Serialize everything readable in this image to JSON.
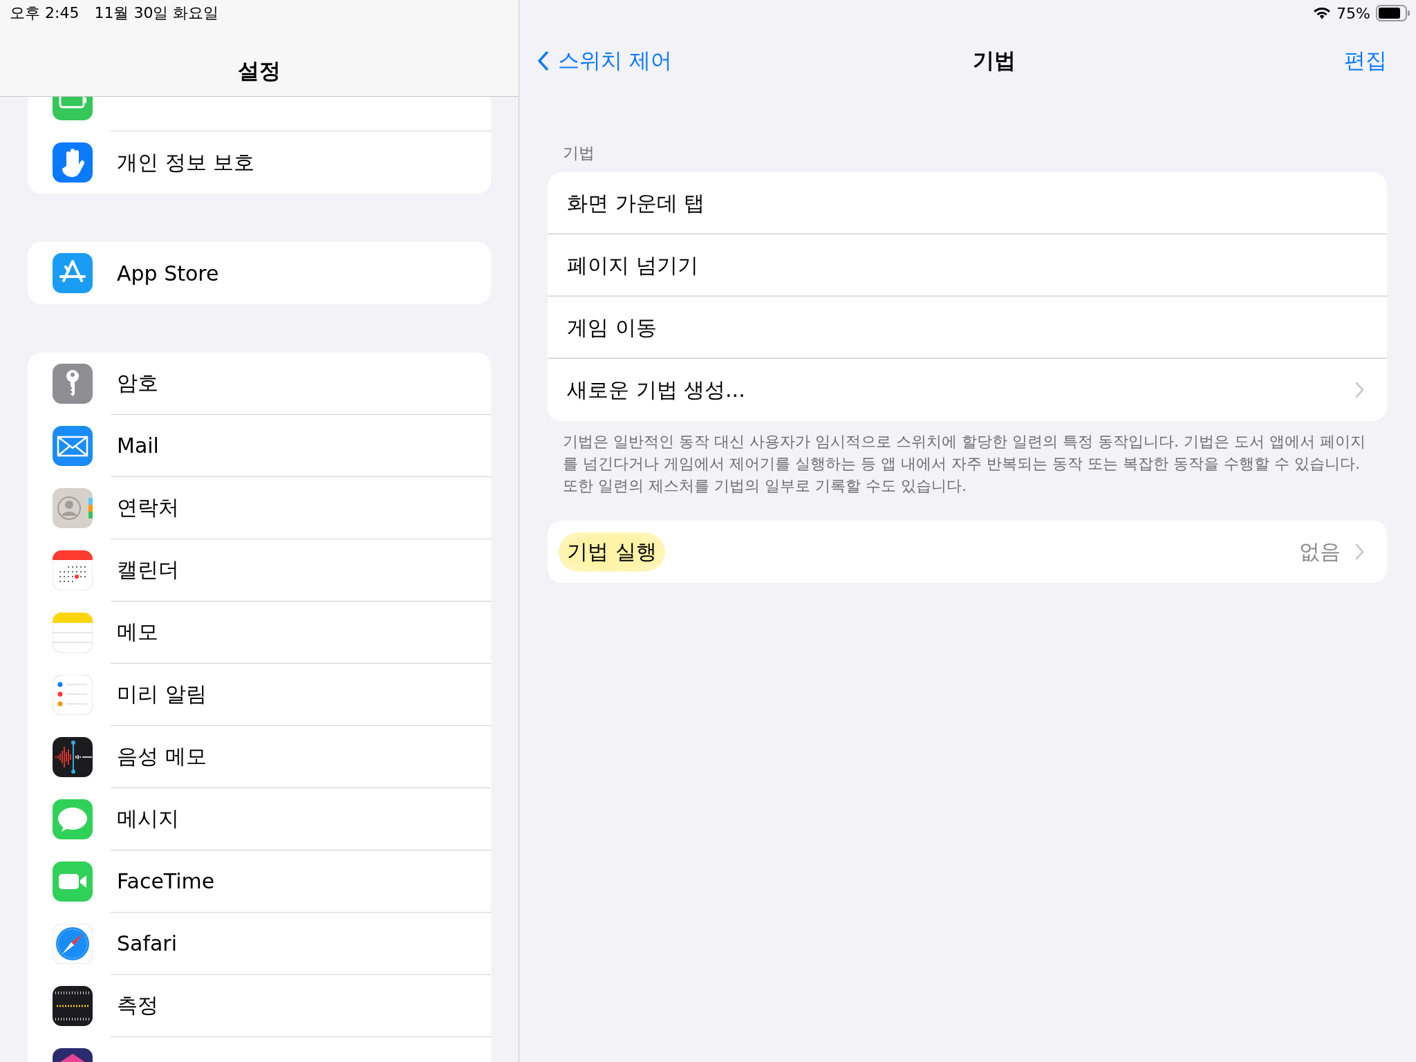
{
  "status_bar": {
    "time": "오후 2:45",
    "date": "11월 30일 화요일",
    "battery": "75%"
  },
  "sidebar": {
    "title": "설정",
    "groups": [
      {
        "items": [
          {
            "kind": "partial"
          },
          {
            "kind": "app",
            "label": "개인 정보 보호"
          }
        ]
      },
      {
        "items": [
          {
            "kind": "app",
            "label": "App Store"
          }
        ]
      },
      {
        "items": [
          {
            "kind": "app",
            "label": "암호"
          },
          {
            "kind": "app",
            "label": "Mail"
          },
          {
            "kind": "app",
            "label": "연락처"
          },
          {
            "kind": "app",
            "label": "캘린더"
          },
          {
            "kind": "app",
            "label": "메모"
          },
          {
            "kind": "app",
            "label": "미리 알림"
          },
          {
            "kind": "app",
            "label": "음성 메모"
          },
          {
            "kind": "app",
            "label": "메시지"
          },
          {
            "kind": "app",
            "label": "FaceTime"
          },
          {
            "kind": "app",
            "label": "Safari"
          },
          {
            "kind": "app",
            "label": "측정"
          },
          {
            "kind": "partial"
          }
        ]
      }
    ]
  },
  "detail": {
    "back": "스위치 제어",
    "title": "기법",
    "action": "편집",
    "section_header": "기법",
    "gestures": [
      {
        "label": "화면 가운데 탭",
        "kind": "plain"
      },
      {
        "label": "페이지 넘기기",
        "kind": "plain"
      },
      {
        "label": "게임 이동",
        "kind": "plain"
      },
      {
        "label": "새로운 기법 생성...",
        "kind": "link"
      }
    ],
    "footer": "기법은 일반적인 동작 대신 사용자가 임시적으로 스위치에 할당한 일련의 특정 동작입니다. 기법은 도서 앱에서 페이지를 넘긴다거나 게임에서 제어기를 실행하는 등 앱 내에서 자주 반복되는 동작 또는 복잡한 동작을 수행할 수 있습니다. 또한 일련의 제스처를 기법의 일부로 기록할 수도 있습니다.",
    "run_row": {
      "label": "기법 실행",
      "value": "없음",
      "highlighted": true
    }
  }
}
